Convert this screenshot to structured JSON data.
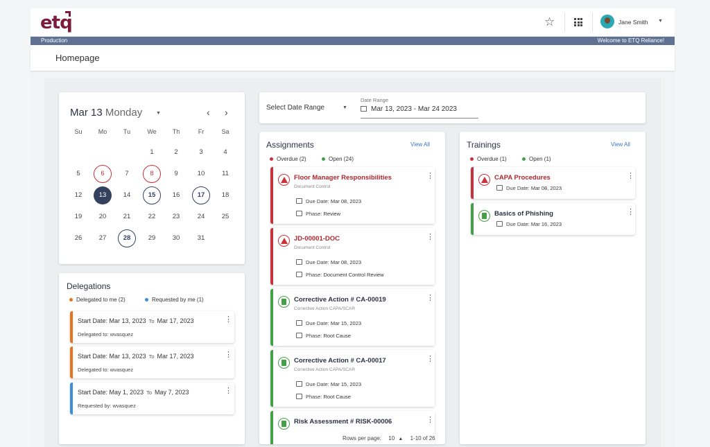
{
  "header": {
    "logo": "etq",
    "user_name": "Jane Smith",
    "env_label": "Production",
    "welcome": "Welcome to ETQ Reliance!"
  },
  "page_title": "Homepage",
  "calendar": {
    "month": "Mar 13",
    "weekday": "Monday",
    "prev": "‹",
    "next": "›",
    "dow": [
      "Su",
      "Mo",
      "Tu",
      "We",
      "Th",
      "Fr",
      "Sa"
    ],
    "weeks": [
      [
        "",
        "",
        "",
        "1",
        "2",
        "3",
        "4"
      ],
      [
        "5",
        "6",
        "7",
        "8",
        "9",
        "10",
        "11"
      ],
      [
        "12",
        "13",
        "14",
        "15",
        "16",
        "17",
        "18"
      ],
      [
        "19",
        "20",
        "21",
        "22",
        "23",
        "24",
        "25"
      ],
      [
        "26",
        "27",
        "28",
        "29",
        "30",
        "31",
        ""
      ]
    ],
    "overdue_days": [
      "6",
      "8"
    ],
    "open_days": [
      "15",
      "17",
      "28"
    ],
    "selected_day": "13"
  },
  "delegations": {
    "title": "Delegations",
    "legend_to_me": "Delegated to me (2)",
    "legend_by_me": "Requested by me (1)",
    "items": [
      {
        "start_label": "Start Date:",
        "start": "Mar 13, 2023",
        "to": "To",
        "end": "Mar 17, 2023",
        "who_label": "Delegated to:",
        "who": "wvasquez",
        "kind": "to-me"
      },
      {
        "start_label": "Start Date:",
        "start": "Mar 13, 2023",
        "to": "To",
        "end": "Mar 17, 2023",
        "who_label": "Delegated to:",
        "who": "wvasquez",
        "kind": "to-me"
      },
      {
        "start_label": "Start Date:",
        "start": "May 1, 2023",
        "to": "To",
        "end": "May 7, 2023",
        "who_label": "Requested by:",
        "who": "wvasquez",
        "kind": "by-me"
      }
    ]
  },
  "date_range": {
    "select_label": "Select Date Range",
    "field_label": "Date Range",
    "value": "Mar 13, 2023 - Mar 24 2023"
  },
  "assignments": {
    "title": "Assignments",
    "view_all": "View All",
    "overdue": "Overdue (2)",
    "open": "Open (24)",
    "items": [
      {
        "title": "Floor Manager Responsibilities",
        "sub": "Document Control",
        "due_label": "Due Date:",
        "due": "Mar 08, 2023",
        "phase_label": "Phase:",
        "phase": "Review",
        "status": "overdue"
      },
      {
        "title": "JD-00001-DOC",
        "sub": "Document Control",
        "due_label": "Due Date:",
        "due": "Mar 08, 2023",
        "phase_label": "Phase:",
        "phase": "Document Control Review",
        "status": "overdue"
      },
      {
        "title": "Corrective Action # CA-00019",
        "sub": "Corrective Action CAPA/SCAR",
        "due_label": "Due Date:",
        "due": "Mar 15, 2023",
        "phase_label": "Phase:",
        "phase": "Root Cause",
        "status": "open"
      },
      {
        "title": "Corrective Action # CA-00017",
        "sub": "Corrective Action CAPA/SCAR",
        "due_label": "Due Date:",
        "due": "Mar 15, 2023",
        "phase_label": "Phase:",
        "phase": "Root Cause",
        "status": "open"
      },
      {
        "title": "Risk Assessment # RISK-00006",
        "sub": "",
        "status": "open"
      }
    ],
    "pager": {
      "rows_label": "Rows per page:",
      "rows": "10",
      "range": "1-10 of 26"
    }
  },
  "trainings": {
    "title": "Trainings",
    "view_all": "View All",
    "overdue": "Overdue (1)",
    "open": "Open (1)",
    "items": [
      {
        "title": "CAPA Procedures",
        "due_label": "Due Date:",
        "due": "Mar 08, 2023",
        "status": "overdue"
      },
      {
        "title": "Basics of Phishing",
        "due_label": "Due Date:",
        "due": "Mar 16, 2023",
        "status": "open"
      }
    ]
  },
  "colors": {
    "overdue": "#c8323a",
    "open": "#43a047",
    "delegated_to_me": "#e8731c",
    "requested_by_me": "#3b8fd8",
    "env_bar": "#5f7293",
    "selected_day": "#34415e"
  }
}
